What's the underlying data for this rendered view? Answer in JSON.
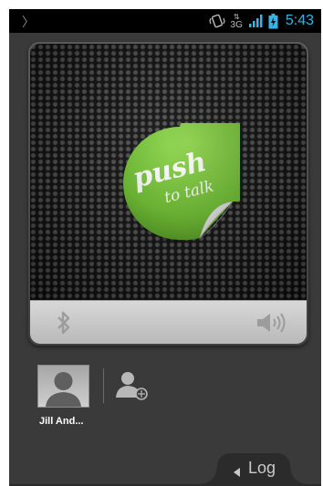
{
  "status_bar": {
    "left_glyph": "〉",
    "network_type": "3G",
    "time": "5:43",
    "icons": [
      "vibrate-icon",
      "data-activity-icon",
      "signal-icon",
      "battery-charging-icon"
    ]
  },
  "ptt_button": {
    "line1": "push",
    "line2": "to talk",
    "icon": "push-to-talk-sticker",
    "color": "#6cc02c"
  },
  "controls": {
    "left_icon": "bluetooth-icon",
    "right_icon": "speaker-volume-icon"
  },
  "contacts": [
    {
      "name": "Jill And...",
      "icon": "avatar-placeholder-icon"
    }
  ],
  "add_contact": {
    "icon": "add-contact-icon"
  },
  "log_tab": {
    "label": "Log",
    "icon": "triangle-left-icon"
  },
  "colors": {
    "accent_clock": "#33b5e5",
    "background": "#3a3a3a"
  }
}
